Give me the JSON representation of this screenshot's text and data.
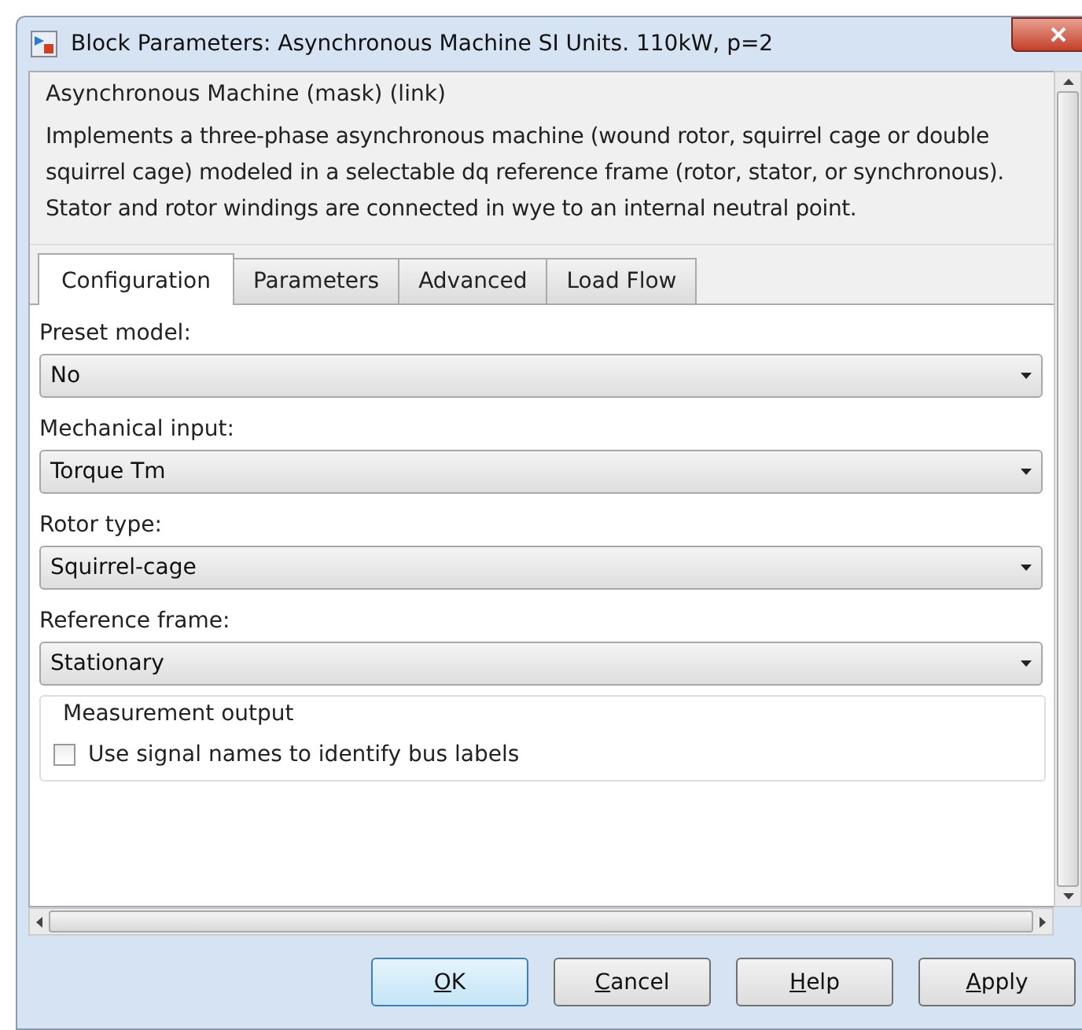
{
  "window": {
    "title": "Block Parameters: Asynchronous Machine SI Units. 110kW, p=2"
  },
  "description": {
    "heading": "Asynchronous Machine (mask) (link)",
    "text": "Implements a three-phase asynchronous machine (wound rotor, squirrel cage or double squirrel cage) modeled in a selectable dq reference frame (rotor, stator, or synchronous). Stator and rotor windings are connected in wye to an internal neutral point."
  },
  "tabs": [
    {
      "label": "Configuration",
      "selected": true
    },
    {
      "label": "Parameters",
      "selected": false
    },
    {
      "label": "Advanced",
      "selected": false
    },
    {
      "label": "Load Flow",
      "selected": false
    }
  ],
  "fields": [
    {
      "label": "Preset model:",
      "value": "No"
    },
    {
      "label": "Mechanical input:",
      "value": "Torque Tm"
    },
    {
      "label": "Rotor type:",
      "value": "Squirrel-cage"
    },
    {
      "label": "Reference frame:",
      "value": "Stationary"
    }
  ],
  "measurement_group": {
    "title": "Measurement output",
    "checkbox": {
      "label": "Use signal names to identify bus labels",
      "checked": false
    }
  },
  "buttons": [
    {
      "label": "OK",
      "selected": true
    },
    {
      "label": "Cancel",
      "selected": false
    },
    {
      "label": "Help",
      "selected": false
    },
    {
      "label": "Apply",
      "selected": false
    }
  ]
}
